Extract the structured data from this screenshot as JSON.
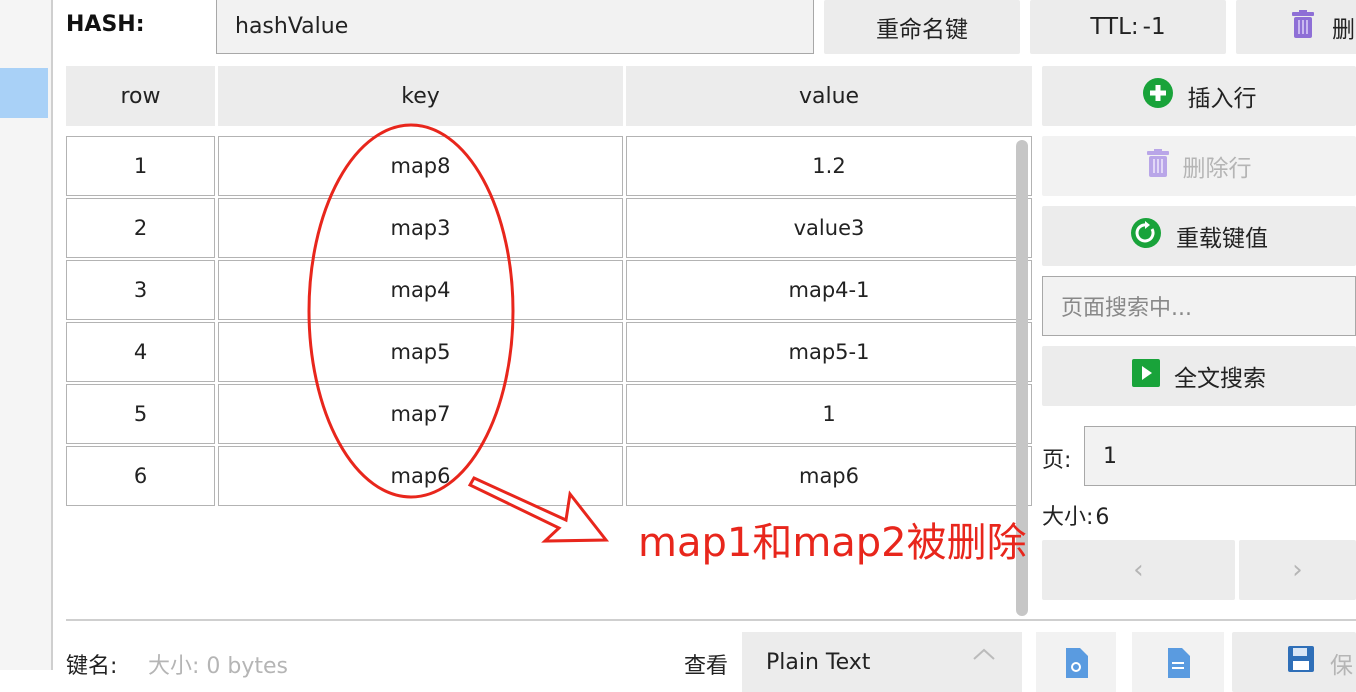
{
  "header": {
    "type_label": "HASH:",
    "key_value": "hashValue",
    "rename_label": "重命名键",
    "ttl_label": "TTL:",
    "ttl_value": "-1",
    "delete_label": "删"
  },
  "table": {
    "columns": [
      "row",
      "key",
      "value"
    ],
    "rows": [
      {
        "row": "1",
        "key": "map8",
        "value": "1.2"
      },
      {
        "row": "2",
        "key": "map3",
        "value": "value3"
      },
      {
        "row": "3",
        "key": "map4",
        "value": "map4-1"
      },
      {
        "row": "4",
        "key": "map5",
        "value": "map5-1"
      },
      {
        "row": "5",
        "key": "map7",
        "value": "1"
      },
      {
        "row": "6",
        "key": "map6",
        "value": "map6"
      }
    ]
  },
  "side": {
    "insert_label": "插入行",
    "delete_row_label": "删除行",
    "reload_label": "重载键值",
    "search_placeholder": "页面搜索中...",
    "fulltext_label": "全文搜索",
    "page_label": "页:",
    "page_value": "1",
    "size_label": "大小:",
    "size_value": "6",
    "prev": "‹",
    "next": "›"
  },
  "annotation": {
    "text": "map1和map2被删除",
    "color": "#e8261c"
  },
  "bottom": {
    "key_name_label": "键名:",
    "size_info": "大小: 0 bytes",
    "view_label": "查看",
    "format_value": "Plain Text",
    "save_label": "保"
  },
  "colors": {
    "accent_green": "#19a33a",
    "trash_purple": "#8e6fd6",
    "selection_blue": "#a9d1f7"
  }
}
